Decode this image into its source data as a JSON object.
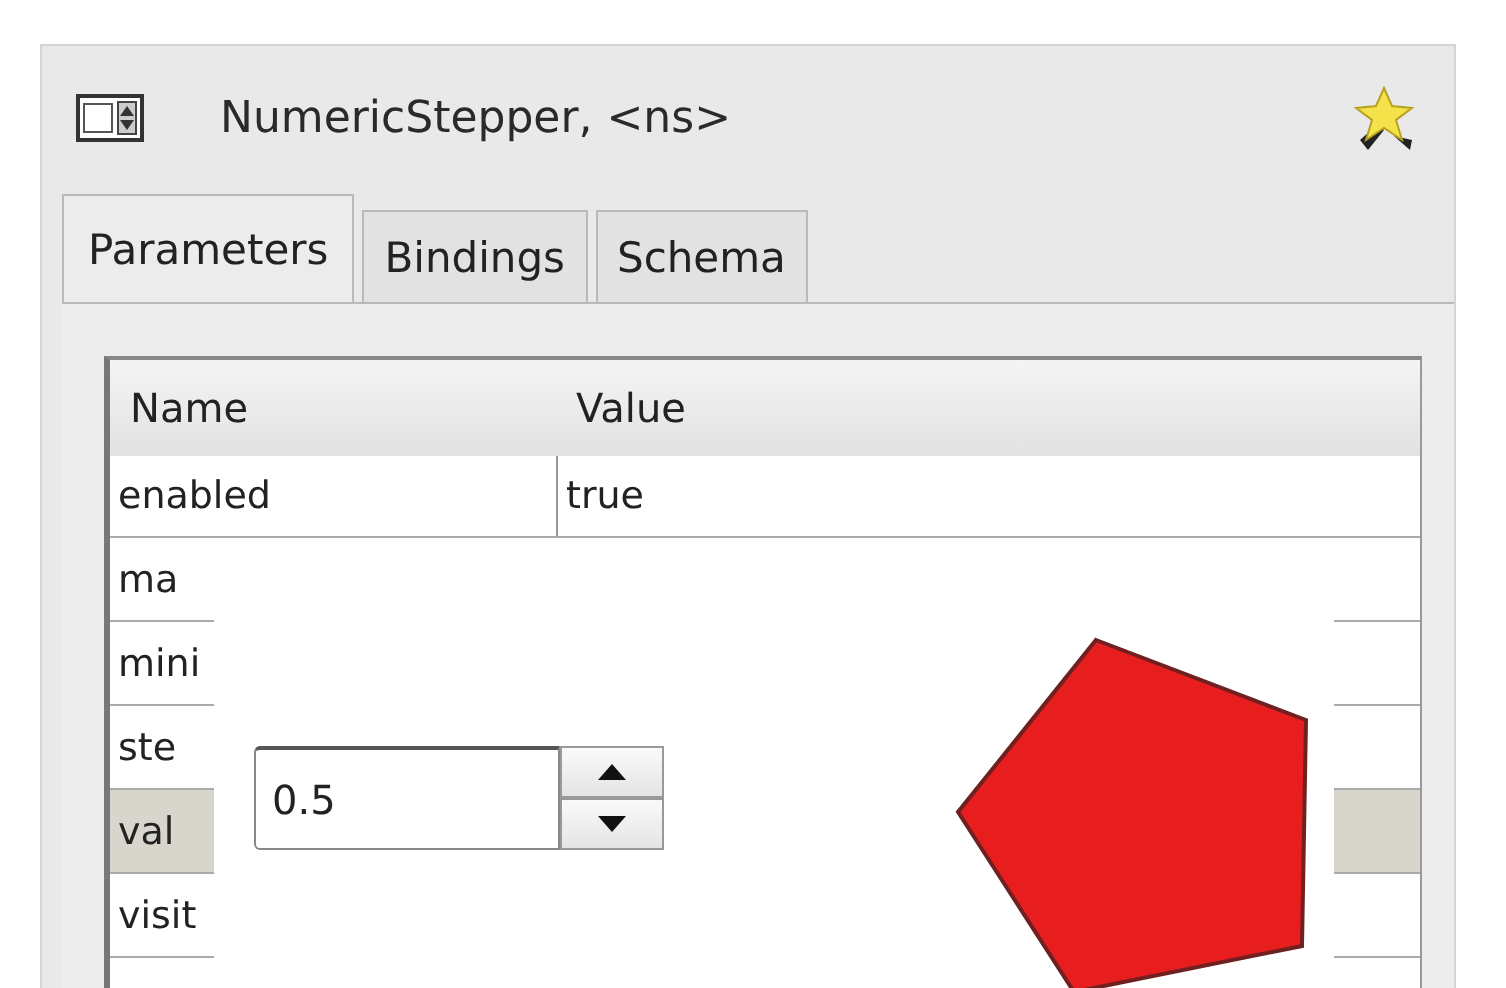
{
  "window": {
    "title": "NumericStepper, <ns>"
  },
  "tabs": [
    {
      "label": "Parameters",
      "selected": true
    },
    {
      "label": "Bindings",
      "selected": false
    },
    {
      "label": "Schema",
      "selected": false
    }
  ],
  "table": {
    "columns": [
      "Name",
      "Value"
    ],
    "rows": [
      {
        "name": "enabled",
        "value": "true",
        "selected": false
      },
      {
        "name": "ma",
        "selected": false
      },
      {
        "name": "mini",
        "selected": false
      },
      {
        "name": "ste",
        "selected": false
      },
      {
        "name": "val",
        "selected": true
      },
      {
        "name": "visit",
        "selected": false
      }
    ]
  },
  "stepper": {
    "value": "0.5"
  }
}
